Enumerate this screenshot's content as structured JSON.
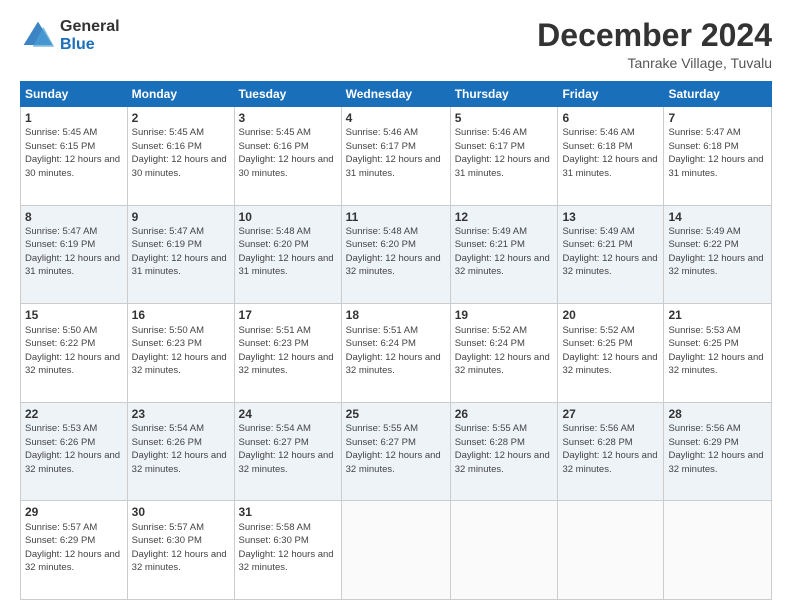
{
  "header": {
    "logo_general": "General",
    "logo_blue": "Blue",
    "month_title": "December 2024",
    "location": "Tanrake Village, Tuvalu"
  },
  "days_of_week": [
    "Sunday",
    "Monday",
    "Tuesday",
    "Wednesday",
    "Thursday",
    "Friday",
    "Saturday"
  ],
  "weeks": [
    [
      {
        "day": 1,
        "sunrise": "5:45 AM",
        "sunset": "6:15 PM",
        "daylight": "12 hours and 30 minutes."
      },
      {
        "day": 2,
        "sunrise": "5:45 AM",
        "sunset": "6:16 PM",
        "daylight": "12 hours and 30 minutes."
      },
      {
        "day": 3,
        "sunrise": "5:45 AM",
        "sunset": "6:16 PM",
        "daylight": "12 hours and 30 minutes."
      },
      {
        "day": 4,
        "sunrise": "5:46 AM",
        "sunset": "6:17 PM",
        "daylight": "12 hours and 31 minutes."
      },
      {
        "day": 5,
        "sunrise": "5:46 AM",
        "sunset": "6:17 PM",
        "daylight": "12 hours and 31 minutes."
      },
      {
        "day": 6,
        "sunrise": "5:46 AM",
        "sunset": "6:18 PM",
        "daylight": "12 hours and 31 minutes."
      },
      {
        "day": 7,
        "sunrise": "5:47 AM",
        "sunset": "6:18 PM",
        "daylight": "12 hours and 31 minutes."
      }
    ],
    [
      {
        "day": 8,
        "sunrise": "5:47 AM",
        "sunset": "6:19 PM",
        "daylight": "12 hours and 31 minutes."
      },
      {
        "day": 9,
        "sunrise": "5:47 AM",
        "sunset": "6:19 PM",
        "daylight": "12 hours and 31 minutes."
      },
      {
        "day": 10,
        "sunrise": "5:48 AM",
        "sunset": "6:20 PM",
        "daylight": "12 hours and 31 minutes."
      },
      {
        "day": 11,
        "sunrise": "5:48 AM",
        "sunset": "6:20 PM",
        "daylight": "12 hours and 32 minutes."
      },
      {
        "day": 12,
        "sunrise": "5:49 AM",
        "sunset": "6:21 PM",
        "daylight": "12 hours and 32 minutes."
      },
      {
        "day": 13,
        "sunrise": "5:49 AM",
        "sunset": "6:21 PM",
        "daylight": "12 hours and 32 minutes."
      },
      {
        "day": 14,
        "sunrise": "5:49 AM",
        "sunset": "6:22 PM",
        "daylight": "12 hours and 32 minutes."
      }
    ],
    [
      {
        "day": 15,
        "sunrise": "5:50 AM",
        "sunset": "6:22 PM",
        "daylight": "12 hours and 32 minutes."
      },
      {
        "day": 16,
        "sunrise": "5:50 AM",
        "sunset": "6:23 PM",
        "daylight": "12 hours and 32 minutes."
      },
      {
        "day": 17,
        "sunrise": "5:51 AM",
        "sunset": "6:23 PM",
        "daylight": "12 hours and 32 minutes."
      },
      {
        "day": 18,
        "sunrise": "5:51 AM",
        "sunset": "6:24 PM",
        "daylight": "12 hours and 32 minutes."
      },
      {
        "day": 19,
        "sunrise": "5:52 AM",
        "sunset": "6:24 PM",
        "daylight": "12 hours and 32 minutes."
      },
      {
        "day": 20,
        "sunrise": "5:52 AM",
        "sunset": "6:25 PM",
        "daylight": "12 hours and 32 minutes."
      },
      {
        "day": 21,
        "sunrise": "5:53 AM",
        "sunset": "6:25 PM",
        "daylight": "12 hours and 32 minutes."
      }
    ],
    [
      {
        "day": 22,
        "sunrise": "5:53 AM",
        "sunset": "6:26 PM",
        "daylight": "12 hours and 32 minutes."
      },
      {
        "day": 23,
        "sunrise": "5:54 AM",
        "sunset": "6:26 PM",
        "daylight": "12 hours and 32 minutes."
      },
      {
        "day": 24,
        "sunrise": "5:54 AM",
        "sunset": "6:27 PM",
        "daylight": "12 hours and 32 minutes."
      },
      {
        "day": 25,
        "sunrise": "5:55 AM",
        "sunset": "6:27 PM",
        "daylight": "12 hours and 32 minutes."
      },
      {
        "day": 26,
        "sunrise": "5:55 AM",
        "sunset": "6:28 PM",
        "daylight": "12 hours and 32 minutes."
      },
      {
        "day": 27,
        "sunrise": "5:56 AM",
        "sunset": "6:28 PM",
        "daylight": "12 hours and 32 minutes."
      },
      {
        "day": 28,
        "sunrise": "5:56 AM",
        "sunset": "6:29 PM",
        "daylight": "12 hours and 32 minutes."
      }
    ],
    [
      {
        "day": 29,
        "sunrise": "5:57 AM",
        "sunset": "6:29 PM",
        "daylight": "12 hours and 32 minutes."
      },
      {
        "day": 30,
        "sunrise": "5:57 AM",
        "sunset": "6:30 PM",
        "daylight": "12 hours and 32 minutes."
      },
      {
        "day": 31,
        "sunrise": "5:58 AM",
        "sunset": "6:30 PM",
        "daylight": "12 hours and 32 minutes."
      },
      null,
      null,
      null,
      null
    ]
  ]
}
